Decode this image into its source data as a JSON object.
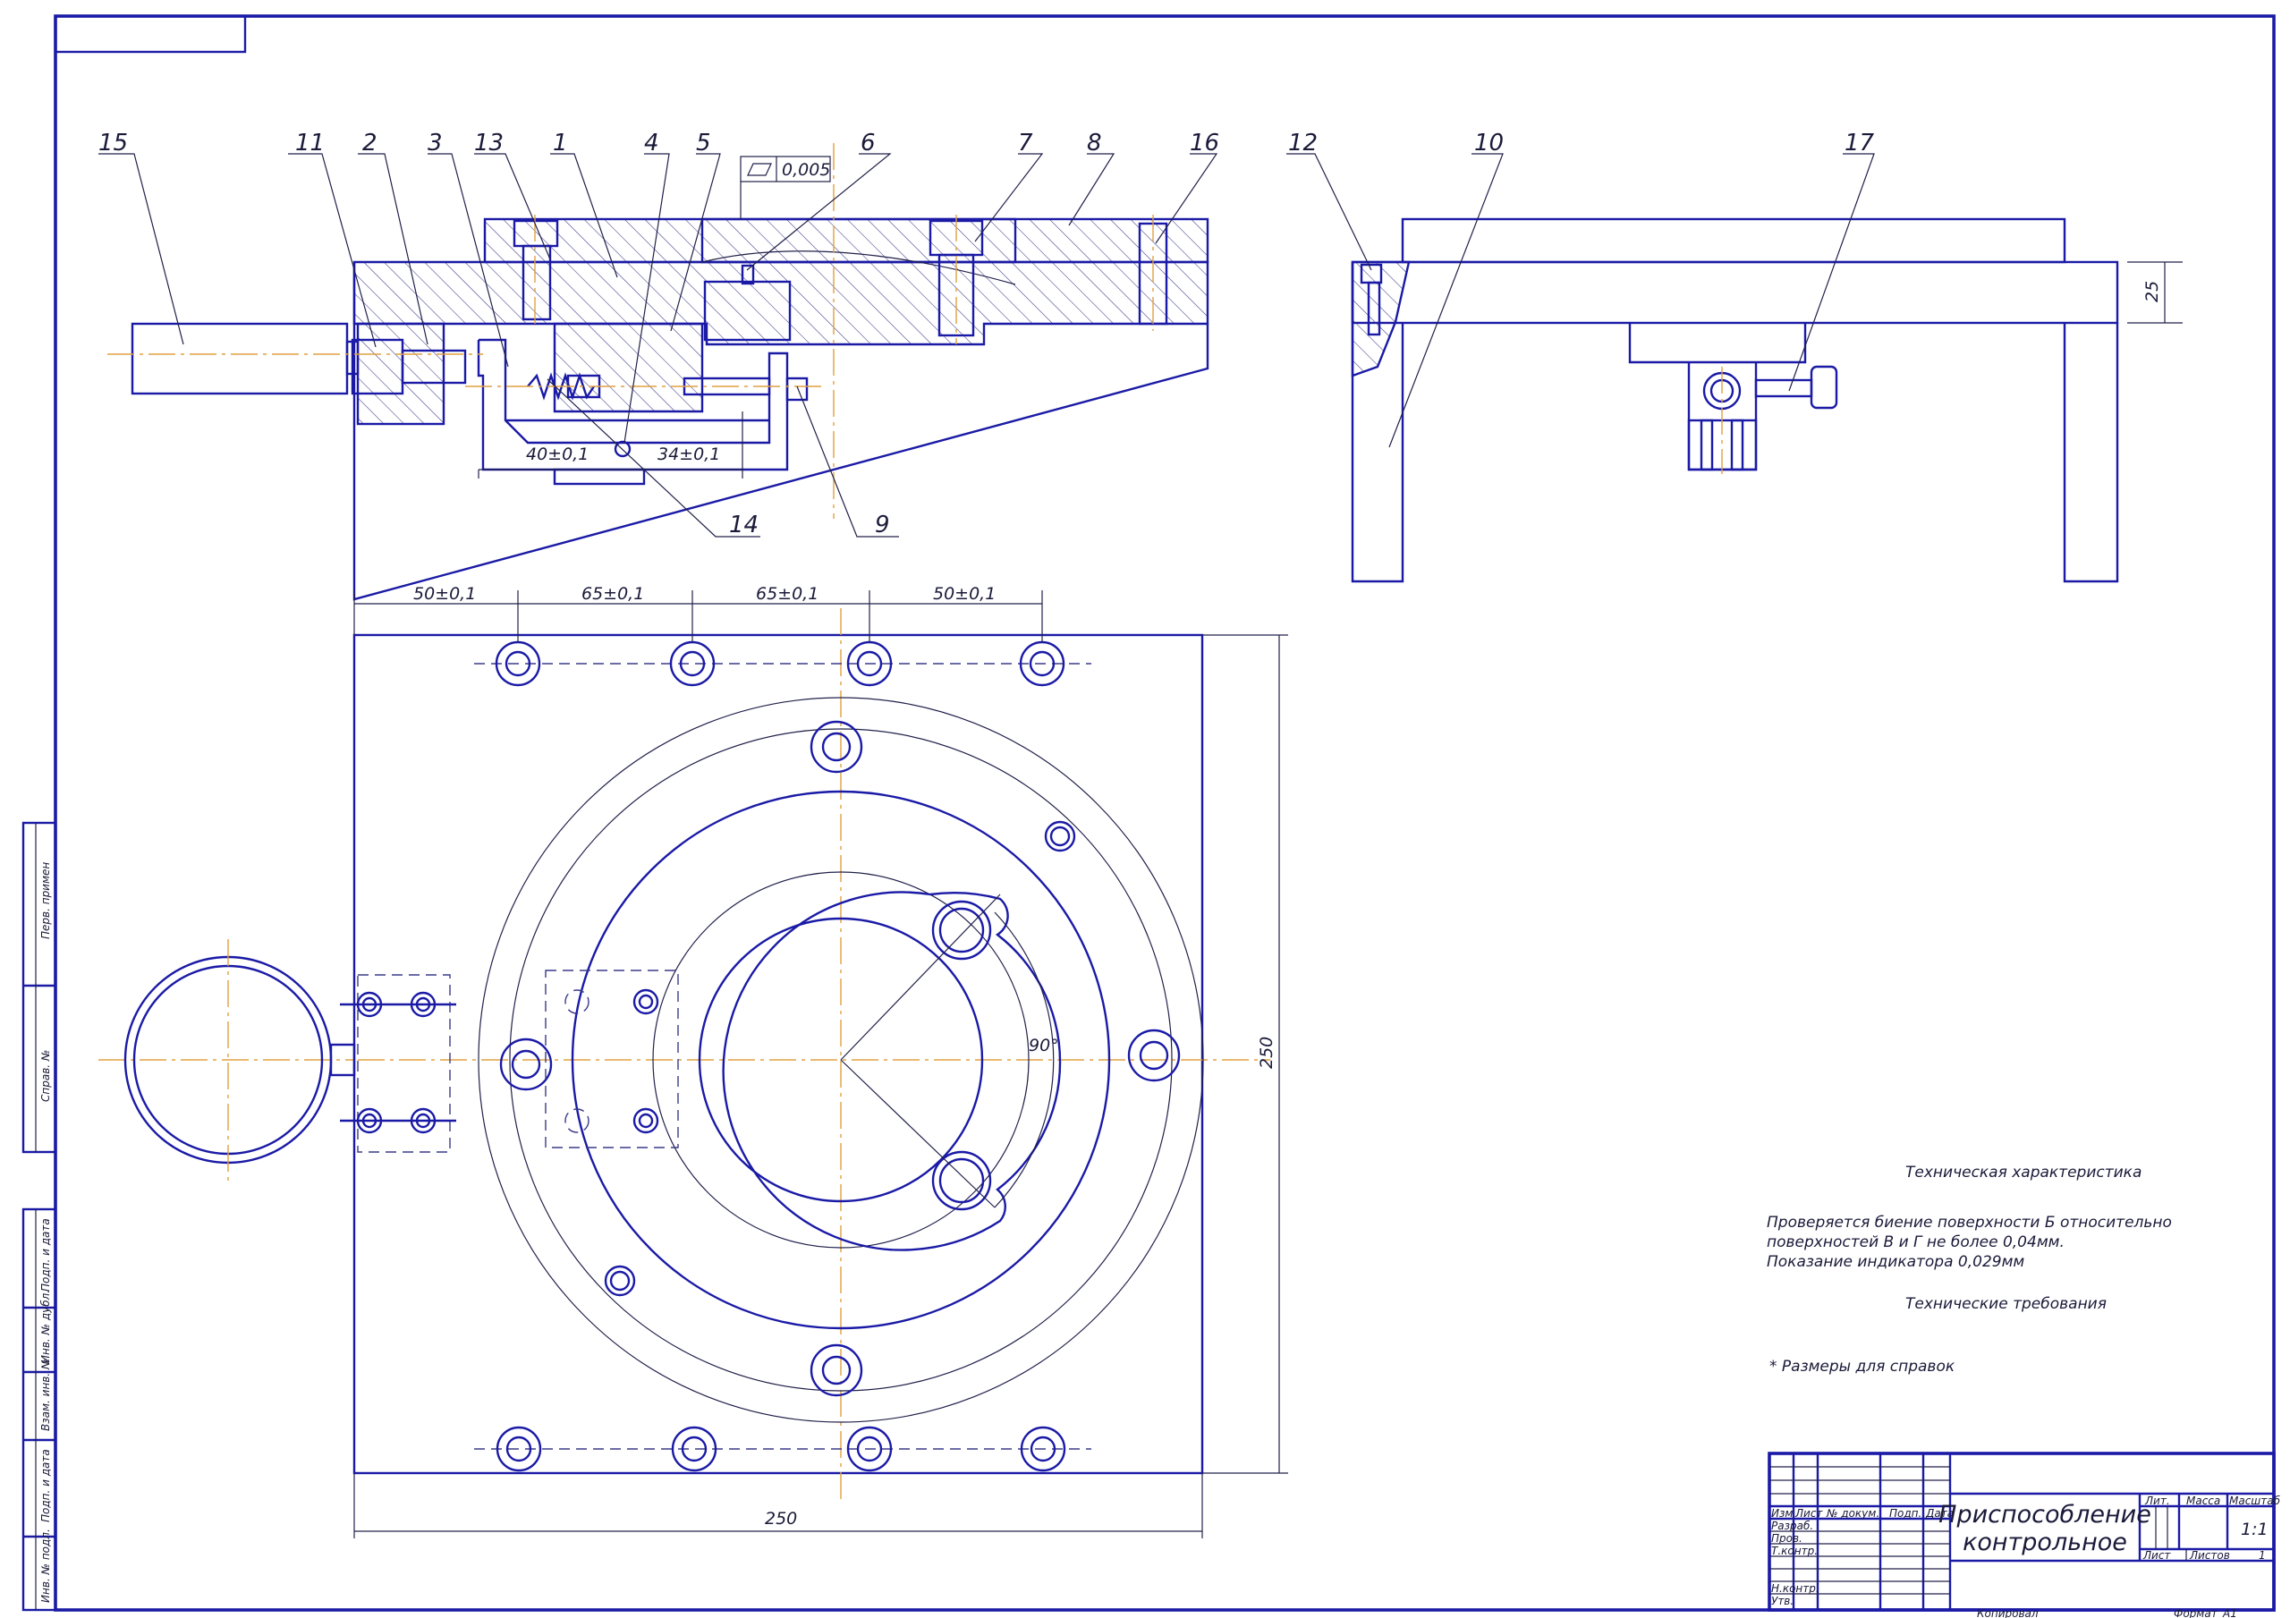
{
  "drawing": {
    "colors": {
      "outline": "#1a1aa6",
      "center_line": "#e0a040",
      "text": "#1a1a3a"
    },
    "callouts": [
      "15",
      "11",
      "2",
      "3",
      "13",
      "1",
      "4",
      "5",
      "6",
      "7",
      "8",
      "16",
      "12",
      "10",
      "17",
      "14",
      "9"
    ],
    "tolerance_frame": "0,005",
    "dimensions": {
      "sec_left": "40±0,1",
      "sec_right": "34±0,1",
      "h1": "50±0,1",
      "h2": "65±0,1",
      "h3": "65±0,1",
      "h4": "50±0,1",
      "height_right": "250",
      "width_bottom": "250",
      "angle": "90°",
      "side_25": "25"
    },
    "notes": {
      "tech_char_title": "Техническая характеристика",
      "line1": "Проверяется биение поверхности Б относительно",
      "line2": "поверхностей В и Г не более 0,04мм.",
      "line3": "Показание индикатора 0,029мм",
      "tech_req_title": "Технические требования",
      "ref": "* Размеры для справок"
    },
    "left_strip": [
      "Перв. примен",
      "Справ. №",
      "Подп. и дата",
      "Инв. № дубл.",
      "Взам. инв. №",
      "Подп. и дата",
      "Инв. № подл."
    ],
    "title_block": {
      "name_line1": "Приспособление",
      "name_line2": "контрольное",
      "h_izm": "Изм",
      "h_list": "Лист",
      "h_docnum": "№ докум.",
      "h_sign": "Подп.",
      "h_date": "Дата",
      "r_razrab": "Разраб.",
      "r_prov": "Пров.",
      "r_tkontr": "Т.контр.",
      "r_nkontr": "Н.контр.",
      "r_utv": "Утв.",
      "lit": "Лит.",
      "massa": "Масса",
      "masshtab": "Масштаб",
      "scale_value": "1:1",
      "list": "Лист",
      "listov": "Листов",
      "listov_value": "1",
      "copied": "Копировал",
      "format": "Формат",
      "format_value": "A1"
    }
  }
}
